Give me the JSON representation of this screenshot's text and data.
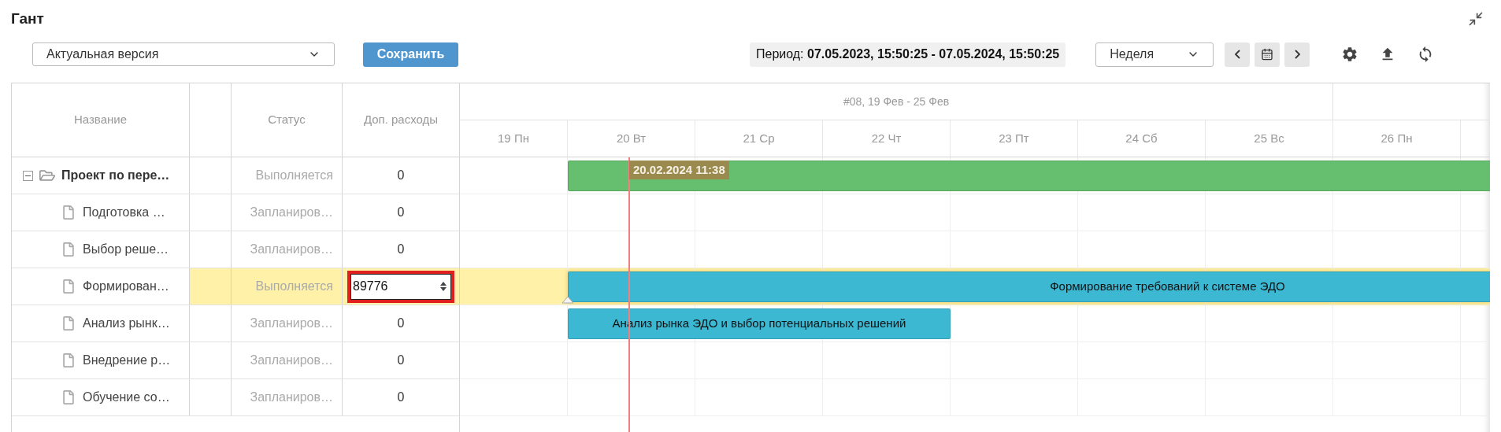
{
  "title": "Гант",
  "toolbar": {
    "version_select": {
      "value": "Актуальная версия"
    },
    "save_button": "Сохранить",
    "period": {
      "label": "Период:",
      "value": "07.05.2023, 15:50:25 - 07.05.2024, 15:50:25"
    },
    "scale_select": {
      "value": "Неделя"
    }
  },
  "table": {
    "columns": [
      {
        "label": "Название"
      },
      {
        "label": "Статус"
      },
      {
        "label": "Доп. расходы"
      }
    ],
    "rows": [
      {
        "kind": "folder",
        "name": "Проект по пере…",
        "status": "Выполняется",
        "expenses": "0",
        "expanded": true,
        "selected": false,
        "editing": false,
        "bar": {
          "color": "#66bf6e"
        },
        "children": [
          {
            "kind": "task",
            "name": "Подготовка …",
            "status": "Запланиров…",
            "expenses": "0",
            "selected": false,
            "editing": false
          },
          {
            "kind": "task",
            "name": "Выбор реше…",
            "status": "Запланиров…",
            "expenses": "0",
            "selected": false,
            "editing": false
          },
          {
            "kind": "task",
            "name": "Формирован…",
            "status": "Выполняется",
            "expenses": "89776",
            "selected": true,
            "editing": true,
            "bar": {
              "color": "#3db8d2",
              "label": "Формирование требований к системе ЭДО"
            }
          },
          {
            "kind": "task",
            "name": "Анализ рынк…",
            "status": "Запланиров…",
            "expenses": "0",
            "selected": false,
            "editing": false,
            "bar": {
              "color": "#3db8d2",
              "label": "Анализ рынка ЭДО и выбор потенциальных решений"
            }
          },
          {
            "kind": "task",
            "name": "Внедрение р…",
            "status": "Запланиров…",
            "expenses": "0",
            "selected": false,
            "editing": false
          },
          {
            "kind": "task",
            "name": "Обучение со…",
            "status": "Запланиров…",
            "expenses": "0",
            "selected": false,
            "editing": false
          }
        ]
      }
    ]
  },
  "gantt": {
    "week_label": "#08, 19 Фев - 25 Фев",
    "days": [
      {
        "label": "19 Пн"
      },
      {
        "label": "20 Вт"
      },
      {
        "label": "21 Ср"
      },
      {
        "label": "22 Чт"
      },
      {
        "label": "23 Пт"
      },
      {
        "label": "24 Сб"
      },
      {
        "label": "25 Вс"
      },
      {
        "label": "26 Пн"
      }
    ],
    "today_marker": {
      "label": "20.02.2024 11:38"
    }
  }
}
